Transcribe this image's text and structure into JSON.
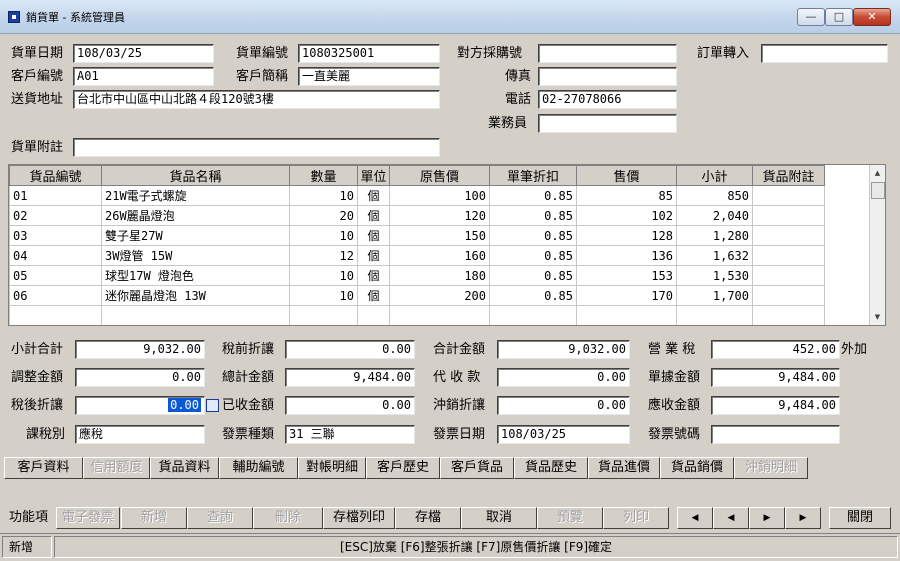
{
  "window": {
    "title": "銷貨單 - 系統管理員",
    "min": "—",
    "max": "□",
    "close": "✕"
  },
  "header": {
    "invoice_date_label": "貨單日期",
    "invoice_date": "108/03/25",
    "invoice_no_label": "貨單編號",
    "invoice_no": "1080325001",
    "po_label": "對方採購號",
    "po": "",
    "order_transfer_label": "訂單轉入",
    "order_transfer": "",
    "customer_code_label": "客戶編號",
    "customer_code": "A01",
    "customer_abbr_label": "客戶簡稱",
    "customer_abbr": "一直美麗",
    "fax_label": "傳真",
    "fax": "",
    "address_label": "送貨地址",
    "address": "台北市中山區中山北路４段120號3樓",
    "phone_label": "電話",
    "phone": "02-27078066",
    "sales_label": "業務員",
    "sales": "",
    "note_label": "貨單附註",
    "note": ""
  },
  "grid": {
    "columns": [
      "貨品編號",
      "貨品名稱",
      "數量",
      "單位",
      "原售價",
      "單筆折扣",
      "售價",
      "小計",
      "貨品附註"
    ],
    "rows": [
      [
        "01",
        "21W電子式螺旋",
        "10",
        "個",
        "100",
        "0.85",
        "85",
        "850",
        ""
      ],
      [
        "02",
        "26W麗晶燈泡",
        "20",
        "個",
        "120",
        "0.85",
        "102",
        "2,040",
        ""
      ],
      [
        "03",
        "雙子星27W",
        "10",
        "個",
        "150",
        "0.85",
        "128",
        "1,280",
        ""
      ],
      [
        "04",
        "3W燈管 15W",
        "12",
        "個",
        "160",
        "0.85",
        "136",
        "1,632",
        ""
      ],
      [
        "05",
        "球型17W 燈泡色",
        "10",
        "個",
        "180",
        "0.85",
        "153",
        "1,530",
        ""
      ],
      [
        "06",
        "迷你麗晶燈泡 13W",
        "10",
        "個",
        "200",
        "0.85",
        "170",
        "1,700",
        ""
      ]
    ],
    "scroll_up": "▲",
    "scroll_down": "▼"
  },
  "totals": {
    "subtotal_label": "小計合計",
    "subtotal": "9,032.00",
    "pre_tax_discount_label": "稅前折讓",
    "pre_tax_discount": "0.00",
    "total_amount_label": "合計金額",
    "total_amount": "9,032.00",
    "business_tax_label": "營 業 稅",
    "business_tax": "452.00",
    "tax_mode": "外加",
    "adjust_label": "調整金額",
    "adjust": "0.00",
    "grand_total_label": "總計金額",
    "grand_total": "9,484.00",
    "collect_label": "代 收 款",
    "collect": "0.00",
    "doc_amount_label": "單據金額",
    "doc_amount": "9,484.00",
    "post_tax_discount_label": "稅後折讓",
    "post_tax_discount": "0.00",
    "received_label": "已收金額",
    "received": "0.00",
    "offset_label": "沖銷折讓",
    "offset": "0.00",
    "receivable_label": "應收金額",
    "receivable": "9,484.00",
    "tax_type_label": "課稅別",
    "tax_type": "應稅",
    "invoice_type_label": "發票種類",
    "invoice_type": "31 三聯",
    "invoice_date_label": "發票日期",
    "invoice_date": "108/03/25",
    "invoice_number_label": "發票號碼",
    "invoice_number": ""
  },
  "tabs": {
    "customer_data": "客戶資料",
    "credit_limit": "信用額度",
    "product_data": "貨品資料",
    "aux_code": "輔助編號",
    "statement": "對帳明細",
    "customer_history": "客戶歷史",
    "customer_products": "客戶貨品",
    "product_history": "貨品歷史",
    "product_purchase": "貨品進價",
    "product_sales": "貨品銷價",
    "offset_detail": "沖銷明細"
  },
  "functions": {
    "label": "功能項",
    "e_invoice": "電子發票",
    "add": "新增",
    "query": "查詢",
    "delete": "刪除",
    "save_print": "存檔列印",
    "save": "存檔",
    "cancel": "取消",
    "preview": "預覽",
    "print": "列印",
    "first": "◀",
    "prev": "◀",
    "next": "▶",
    "last": "▶",
    "close": "關閉"
  },
  "status": {
    "mode": "新增",
    "hint": "[ESC]放棄 [F6]整張折讓 [F7]原售價折讓 [F9]確定"
  }
}
